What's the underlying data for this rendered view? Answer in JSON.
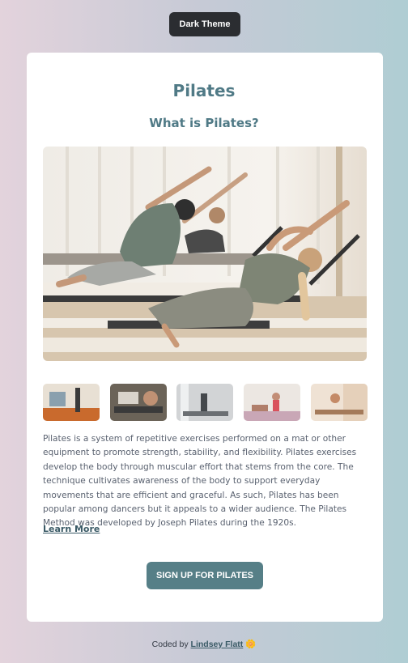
{
  "header": {
    "theme_button_label": "Dark Theme"
  },
  "card": {
    "title": "Pilates",
    "subtitle": "What is Pilates?",
    "description": "Pilates is a system of repetitive exercises performed on a mat or other equipment to promote strength, stability, and flexibility. Pilates exercises develop the body through muscular effort that stems from the core. The technique cultivates awareness of the body to support everyday movements that are efficient and graceful. As such, Pilates has been popular among dancers but it appeals to a wider audience. The Pilates Method was developed by Joseph Pilates during the 1920s.",
    "learn_more_label": "Learn More",
    "signup_label": "SIGN UP FOR PILATES"
  },
  "footer": {
    "prefix": "Coded by",
    "author": "Lindsey Flatt",
    "emoji": "🌼"
  },
  "colors": {
    "accent": "#567f87",
    "title": "#507a86",
    "dark_button": "#2b2d31"
  }
}
